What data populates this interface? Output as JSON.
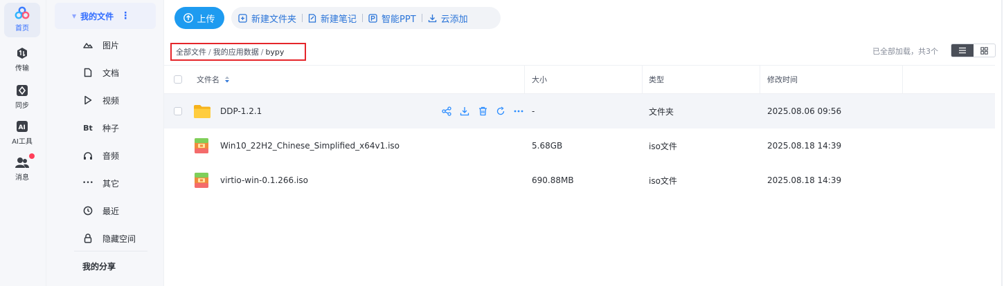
{
  "rail": {
    "items": [
      {
        "label": "首页",
        "icon": "home-cloud-icon",
        "active": true
      },
      {
        "label": "传输",
        "icon": "transfer-icon"
      },
      {
        "label": "同步",
        "icon": "sync-icon"
      },
      {
        "label": "AI工具",
        "icon": "ai-tools-icon"
      },
      {
        "label": "消息",
        "icon": "messages-icon",
        "badge": true
      }
    ],
    "accent": "#2f6bff",
    "badge_color": "#ff3e59"
  },
  "sidebar": {
    "header": "我的文件",
    "items": [
      {
        "label": "图片",
        "icon": "image-icon"
      },
      {
        "label": "文档",
        "icon": "document-icon"
      },
      {
        "label": "视频",
        "icon": "video-play-icon"
      },
      {
        "label": "种子",
        "icon": "bt-torrent-icon",
        "glyph": "Bt"
      },
      {
        "label": "音频",
        "icon": "headphones-icon"
      },
      {
        "label": "其它",
        "icon": "more-dots-icon",
        "glyph": "•••"
      },
      {
        "label": "最近",
        "icon": "recent-clock-icon"
      },
      {
        "label": "隐藏空间",
        "icon": "lock-icon"
      }
    ],
    "share": "我的分享"
  },
  "toolbar": {
    "upload": "上传",
    "new_folder": "新建文件夹",
    "new_note": "新建笔记",
    "smart_ppt": "智能PPT",
    "cloud_add": "云添加",
    "upload_color": "#1e9bf0",
    "tool_color": "#2a74d8"
  },
  "breadcrumb": {
    "items": [
      "全部文件",
      "我的应用数据",
      "bypy"
    ],
    "separator": "/",
    "highlight_color": "#e5252a"
  },
  "status": {
    "loaded": "已全部加载，共3个"
  },
  "table": {
    "columns": [
      "文件名",
      "大小",
      "类型",
      "修改时间"
    ],
    "rows": [
      {
        "name": "DDP-1.2.1",
        "size": "-",
        "type": "文件夹",
        "modified": "2025.08.06 09:56",
        "icon": "folder-icon",
        "hover": true
      },
      {
        "name": "Win10_22H2_Chinese_Simplified_x64v1.iso",
        "size": "5.68GB",
        "type": "iso文件",
        "modified": "2025.08.18 14:39",
        "icon": "iso-file-icon"
      },
      {
        "name": "virtio-win-0.1.266.iso",
        "size": "690.88MB",
        "type": "iso文件",
        "modified": "2025.08.18 14:39",
        "icon": "iso-file-icon"
      }
    ],
    "row_actions": [
      "share-icon",
      "download-icon",
      "delete-icon",
      "refresh-icon",
      "more-icon"
    ]
  }
}
